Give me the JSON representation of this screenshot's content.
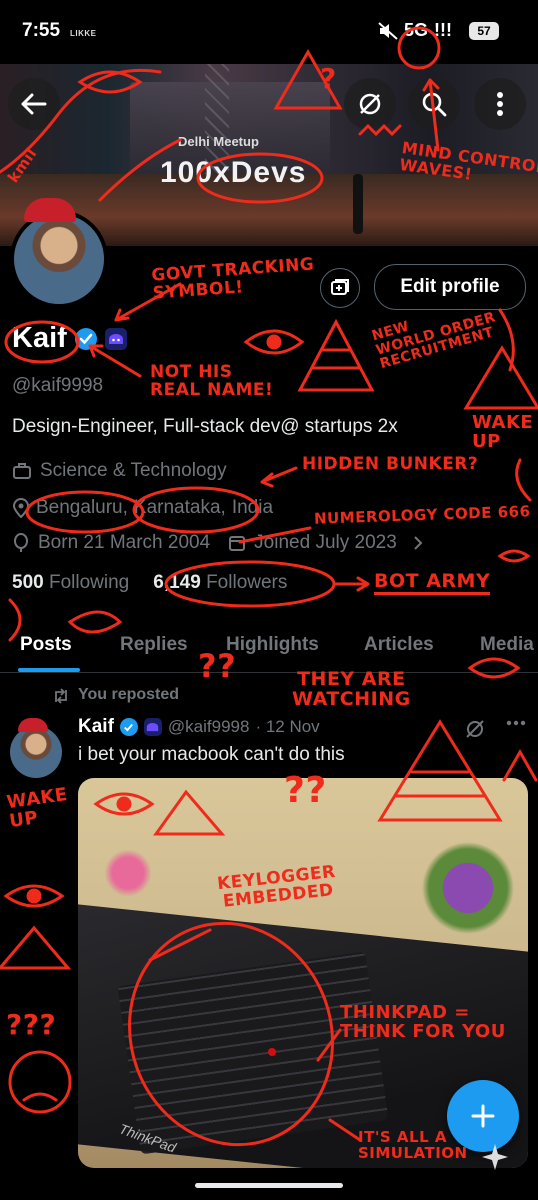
{
  "status_bar": {
    "time": "7:55",
    "carrier": "LIKKE",
    "network": "5G",
    "signal": "!!!",
    "battery": "57"
  },
  "banner": {
    "event_text_top": "Delhi Meetup",
    "event_text": "100xDevs"
  },
  "profile": {
    "edit_profile_label": "Edit profile",
    "name": "Kaif",
    "handle": "@kaif9998",
    "bio": "Design-Engineer, Full-stack dev@ startups 2x",
    "category": "Science & Technology",
    "location_part1": "Bengaluru,",
    "location_part2": "Karnataka,",
    "location_part3": "India",
    "born": "Born 21 March 2004",
    "joined": "Joined July 2023",
    "following_count": "500",
    "following_label": "Following",
    "followers_count": "6,149",
    "followers_label": "Followers"
  },
  "tabs": [
    {
      "label": "Posts",
      "active": true
    },
    {
      "label": "Replies",
      "active": false
    },
    {
      "label": "Highlights",
      "active": false
    },
    {
      "label": "Articles",
      "active": false
    },
    {
      "label": "Media",
      "active": false
    }
  ],
  "post": {
    "repost_label": "You reposted",
    "author": "Kaif",
    "handle": "@kaif9998",
    "date": "· 12 Nov",
    "text": "i bet your macbook can't do this",
    "brand_on_laptop": "ThinkPad"
  },
  "annotations": {
    "kmil": "kmil",
    "govt_tracking": "GOVT TRACKING\nSYMBOL!",
    "mind_control": "MIND CONTROL\nWAVES!",
    "nwo": "NEW\nWORLD ORDER\nRECRUITMENT",
    "not_real_name": "NOT HIS\nREAL NAME!",
    "wake_up_1": "WAKE\nUP",
    "hidden_bunker": "HIDDEN BUNKER?",
    "numerology": "NUMEROLOGY CODE 666",
    "bot_army": "BOT ARMY",
    "they_watching": "THEY ARE\nWATCHING",
    "wake_up_2": "WAKE\nUP",
    "keylogger": "KEYLOGGER\nEMBEDDED",
    "thinkpad": "THINKPAD =\nTHINK FOR YOU",
    "simulation": "IT'S ALL A\nSIMULATION",
    "q_marks_1": "?",
    "q_marks_2": "??",
    "q_marks_3": "???",
    "q_marks_4": "??"
  },
  "colors": {
    "accent": "#1d9bf0",
    "annotation": "#ef2b1c",
    "background": "#000000",
    "muted": "#71767b"
  }
}
